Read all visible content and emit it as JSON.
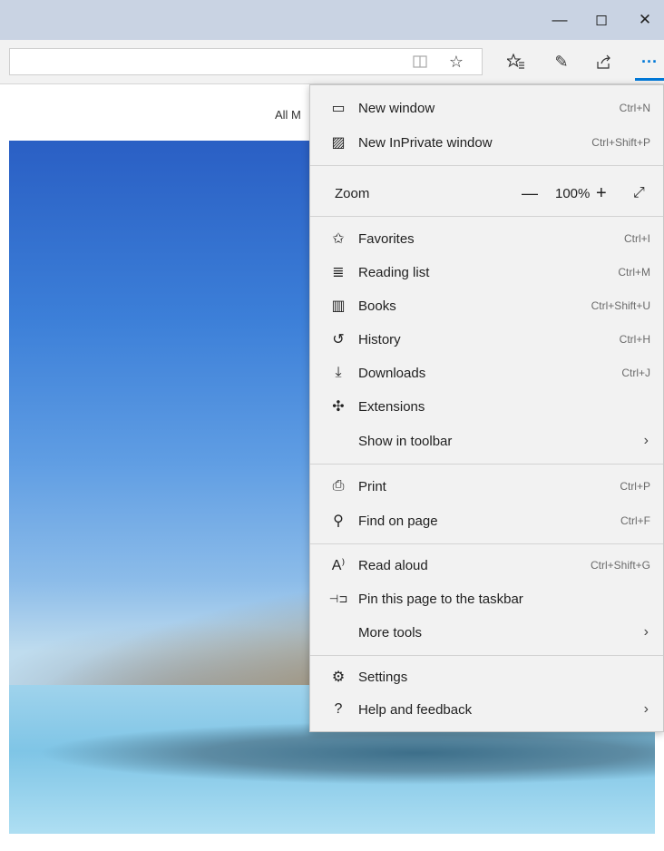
{
  "window_controls": {
    "minimize": "—",
    "maximize": "◻",
    "close": "✕"
  },
  "toolbar": {
    "reading_view": "📖",
    "favorite_star": "☆",
    "favorites_hub": "✩≡",
    "notes": "✎",
    "share": "⇪",
    "more": "···"
  },
  "page": {
    "nav_text": "All M"
  },
  "menu": {
    "new_window": {
      "icon": "▭",
      "label": "New window",
      "shortcut": "Ctrl+N"
    },
    "new_inprivate": {
      "icon": "▨",
      "label": "New InPrivate window",
      "shortcut": "Ctrl+Shift+P"
    },
    "zoom": {
      "label": "Zoom",
      "minus": "—",
      "value": "100%",
      "plus": "+",
      "fullscreen": "⤢"
    },
    "favorites": {
      "icon": "✩",
      "label": "Favorites",
      "shortcut": "Ctrl+I"
    },
    "reading_list": {
      "icon": "≣",
      "label": "Reading list",
      "shortcut": "Ctrl+M"
    },
    "books": {
      "icon": "▥",
      "label": "Books",
      "shortcut": "Ctrl+Shift+U"
    },
    "history": {
      "icon": "↺",
      "label": "History",
      "shortcut": "Ctrl+H"
    },
    "downloads": {
      "icon": "⤓",
      "label": "Downloads",
      "shortcut": "Ctrl+J"
    },
    "extensions": {
      "icon": "✣",
      "label": "Extensions"
    },
    "show_in_toolbar": {
      "label": "Show in toolbar",
      "chevron": "›"
    },
    "print": {
      "icon": "⎙",
      "label": "Print",
      "shortcut": "Ctrl+P"
    },
    "find_on_page": {
      "icon": "⚲",
      "label": "Find on page",
      "shortcut": "Ctrl+F"
    },
    "read_aloud": {
      "icon": "A⁾",
      "label": "Read aloud",
      "shortcut": "Ctrl+Shift+G"
    },
    "pin_taskbar": {
      "icon": "⊣⊐",
      "label": "Pin this page to the taskbar"
    },
    "more_tools": {
      "label": "More tools",
      "chevron": "›"
    },
    "settings": {
      "icon": "⚙",
      "label": "Settings"
    },
    "help": {
      "icon": "?",
      "label": "Help and feedback",
      "chevron": "›"
    }
  },
  "colors": {
    "accent": "#0078d7",
    "highlight": "#f6f23a",
    "menu_bg": "#f2f2f2"
  }
}
